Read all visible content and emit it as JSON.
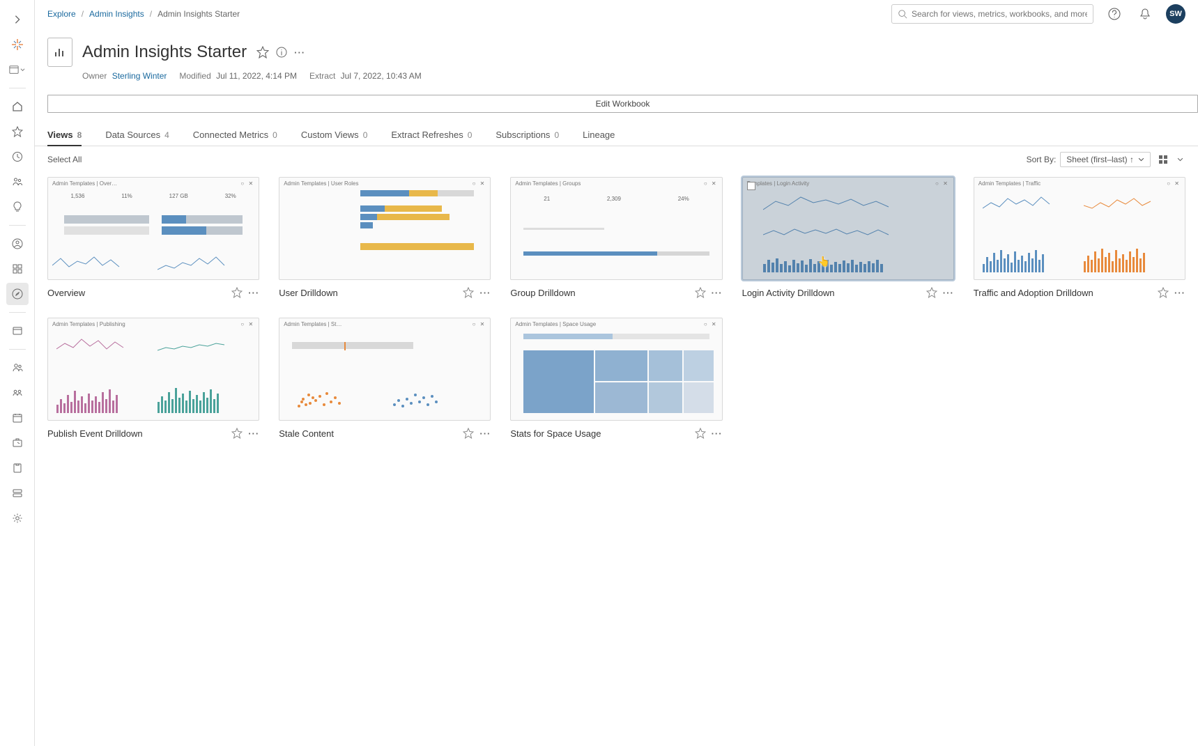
{
  "breadcrumbs": {
    "root": "Explore",
    "parent": "Admin Insights",
    "current": "Admin Insights Starter"
  },
  "search": {
    "placeholder": "Search for views, metrics, workbooks, and more"
  },
  "avatar": {
    "initials": "SW"
  },
  "page": {
    "title": "Admin Insights Starter",
    "owner_label": "Owner",
    "owner": "Sterling Winter",
    "modified_label": "Modified",
    "modified": "Jul 11, 2022, 4:14 PM",
    "extract_label": "Extract",
    "extract": "Jul 7, 2022, 10:43 AM",
    "edit_label": "Edit Workbook"
  },
  "tabs": [
    {
      "label": "Views",
      "count": "8",
      "active": true
    },
    {
      "label": "Data Sources",
      "count": "4"
    },
    {
      "label": "Connected Metrics",
      "count": "0"
    },
    {
      "label": "Custom Views",
      "count": "0"
    },
    {
      "label": "Extract Refreshes",
      "count": "0"
    },
    {
      "label": "Subscriptions",
      "count": "0"
    },
    {
      "label": "Lineage",
      "count": ""
    }
  ],
  "toolbar": {
    "select_all": "Select All",
    "sort_label": "Sort By:",
    "sort_value": "Sheet (first–last) ↑"
  },
  "views": [
    {
      "title": "Overview",
      "sub": "Admin Templates | Over…",
      "kind": "overview"
    },
    {
      "title": "User Drilldown",
      "sub": "Admin Templates | User Roles",
      "kind": "user"
    },
    {
      "title": "Group Drilldown",
      "sub": "Admin Templates | Groups",
      "kind": "group"
    },
    {
      "title": "Login Activity Drilldown",
      "sub": "Templates | Login Activity",
      "kind": "login",
      "selected": true
    },
    {
      "title": "Traffic and Adoption Drilldown",
      "sub": "Admin Templates | Traffic",
      "kind": "traffic"
    },
    {
      "title": "Publish Event Drilldown",
      "sub": "Admin Templates | Publishing",
      "kind": "publish"
    },
    {
      "title": "Stale Content",
      "sub": "Admin Templates | St…",
      "kind": "stale"
    },
    {
      "title": "Stats for Space Usage",
      "sub": "Admin Templates | Space Usage",
      "kind": "space"
    }
  ],
  "overview_stats": {
    "a": "1,536",
    "b": "11%",
    "c": "127 GB",
    "d": "32%"
  },
  "group_stats": {
    "a": "21",
    "b": "2,309",
    "c": "24%"
  }
}
